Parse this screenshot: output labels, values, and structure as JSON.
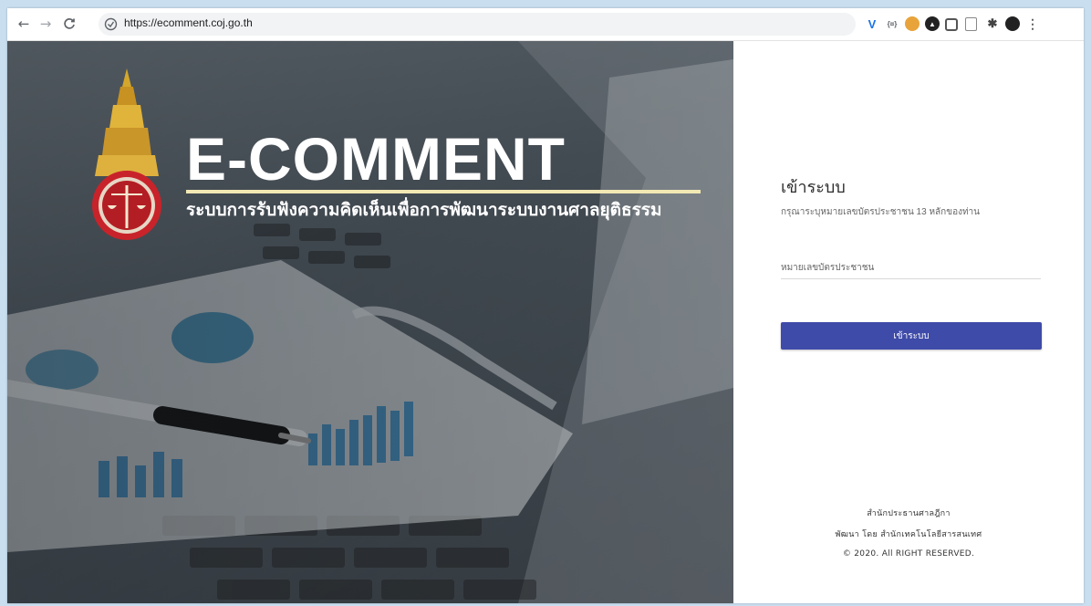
{
  "browser": {
    "url": "https://ecomment.coj.go.th",
    "back_icon": "arrow-left",
    "forward_icon": "arrow-right",
    "reload_icon": "reload",
    "menu_icon": "more-vertical"
  },
  "hero": {
    "title": "E-COMMENT",
    "subtitle": "ระบบการรับฟังความคิดเห็นเพื่อการพัฒนาระบบงานศาลยุติธรรม"
  },
  "login": {
    "title": "เข้าระบบ",
    "subtitle": "กรุณาระบุหมายเลขบัตรประชาชน 13 หลักของท่าน",
    "id_placeholder": "หมายเลขบัตรประชาชน",
    "button_label": "เข้าระบบ",
    "accent_color": "#3f4ba8"
  },
  "footer": {
    "org": "สำนักประธานศาลฎีกา",
    "developer": "พัฒนา โดย สำนักเทคโนโลยีสารสนเทศ",
    "copyright": "© 2020. All RIGHT RESERVED."
  }
}
